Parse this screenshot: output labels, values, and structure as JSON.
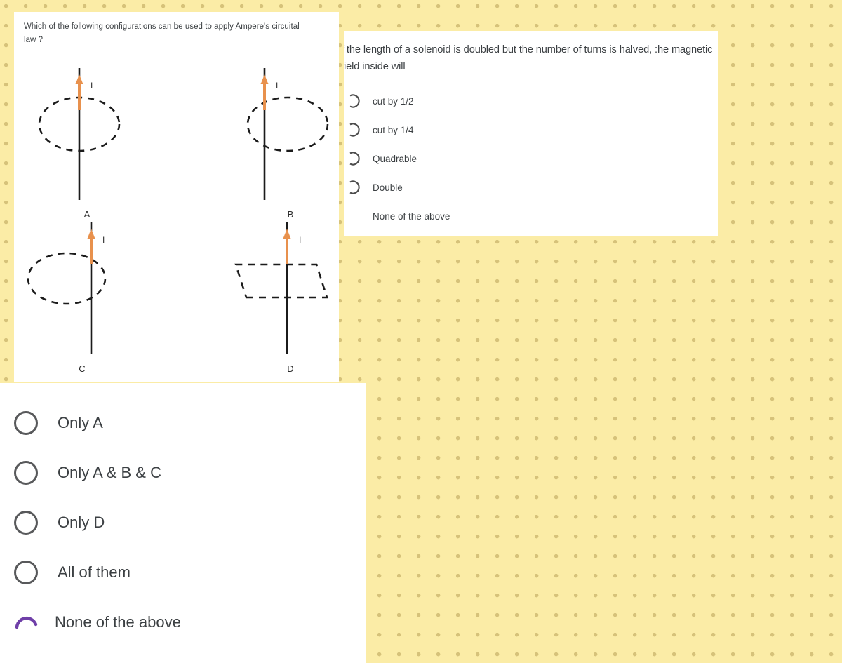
{
  "background": {
    "color": "#fbeca6",
    "dot_color": "#b8a056"
  },
  "question_card": {
    "question": "Which of the following configurations can be used to apply Ampere's circuital law ?",
    "figures": [
      {
        "id": "A",
        "label": "A",
        "current_label": "I",
        "loop_shape": "ellipse",
        "loop_style": "dashed",
        "wire": "vertical",
        "arrow_color": "#e8914d",
        "description": "straight wire through center of dashed ellipse"
      },
      {
        "id": "B",
        "label": "B",
        "current_label": "I",
        "loop_shape": "ellipse",
        "loop_style": "dashed",
        "wire": "vertical",
        "arrow_color": "#e8914d",
        "description": "straight wire through left edge of dashed ellipse"
      },
      {
        "id": "C",
        "label": "C",
        "current_label": "I",
        "loop_shape": "ellipse",
        "loop_style": "dashed",
        "wire": "vertical",
        "arrow_color": "#e8914d",
        "description": "straight wire through right edge of dashed ellipse"
      },
      {
        "id": "D",
        "label": "D",
        "current_label": "I",
        "loop_shape": "parallelogram",
        "loop_style": "dashed",
        "wire": "vertical",
        "arrow_color": "#e8914d",
        "description": "straight wire through dashed parallelogram"
      }
    ]
  },
  "options_panel": {
    "options": [
      {
        "label": "Only A",
        "selected": false,
        "marker": "circle"
      },
      {
        "label": "Only A & B & C",
        "selected": false,
        "marker": "circle"
      },
      {
        "label": "Only D",
        "selected": false,
        "marker": "circle"
      },
      {
        "label": "All of them",
        "selected": false,
        "marker": "circle"
      },
      {
        "label": "None of the above",
        "selected": false,
        "marker": "arc",
        "marker_color": "#6f3fa8"
      }
    ]
  },
  "right_card": {
    "question": "f the length of a solenoid is doubled but the number of turns is halved, :he magnetic field inside will",
    "options": [
      {
        "label": "cut by 1/2",
        "marker": "arc"
      },
      {
        "label": "cut by 1/4",
        "marker": "arc"
      },
      {
        "label": "Quadrable",
        "marker": "arc"
      },
      {
        "label": "Double",
        "marker": "arc"
      },
      {
        "label": "None of the above",
        "marker": "none"
      }
    ]
  }
}
